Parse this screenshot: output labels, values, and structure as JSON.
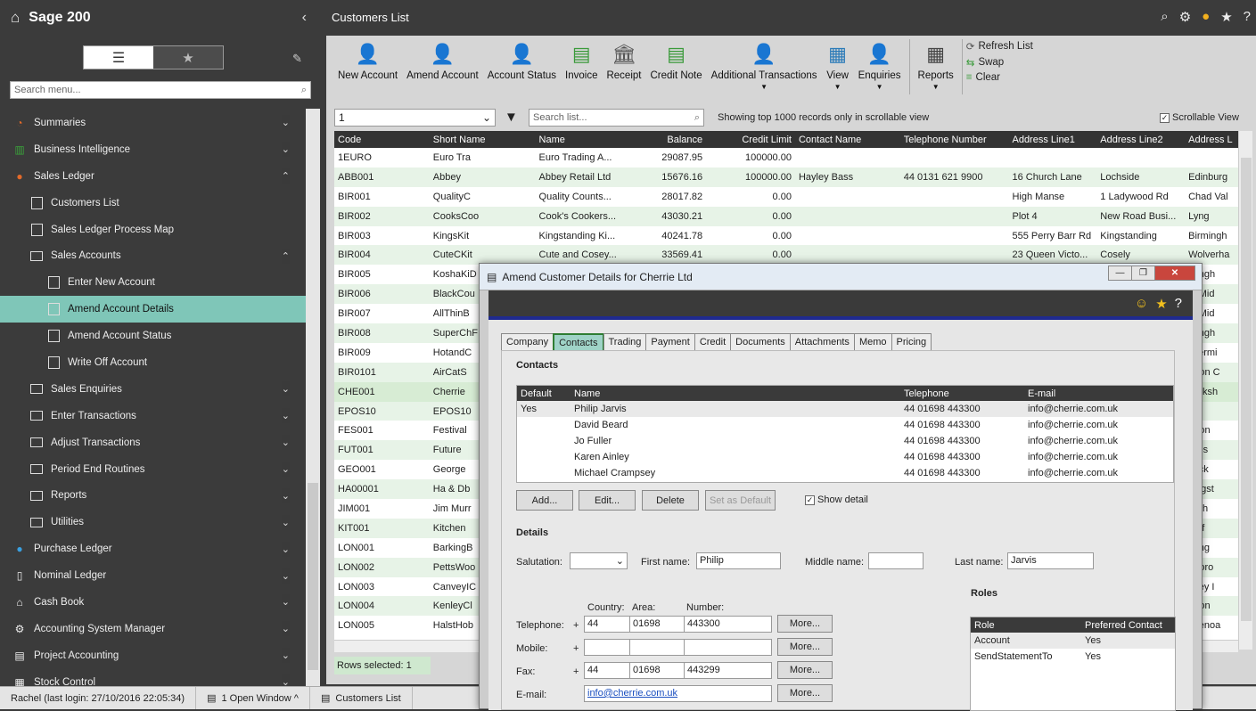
{
  "app": {
    "title": "Sage 200",
    "search_placeholder": "Search menu..."
  },
  "nav": [
    {
      "label": "Summaries",
      "level": 0,
      "icon": "pie-chart-icon",
      "chev": "⌄",
      "sel": false
    },
    {
      "label": "Business Intelligence",
      "level": 0,
      "icon": "bi-icon",
      "chev": "⌄",
      "sel": false
    },
    {
      "label": "Sales Ledger",
      "level": 0,
      "icon": "person-icon",
      "chev": "⌃",
      "sel": false
    },
    {
      "label": "Customers List",
      "level": 1,
      "icon": "list-icon",
      "chev": "",
      "sel": false
    },
    {
      "label": "Sales Ledger Process Map",
      "level": 1,
      "icon": "process-map-icon",
      "chev": "",
      "sel": false
    },
    {
      "label": "Sales Accounts",
      "level": 1,
      "icon": "folder-icon",
      "chev": "⌃",
      "sel": false
    },
    {
      "label": "Enter New Account",
      "level": 2,
      "icon": "form-icon",
      "chev": "",
      "sel": false
    },
    {
      "label": "Amend Account Details",
      "level": 2,
      "icon": "form-icon",
      "chev": "",
      "sel": true
    },
    {
      "label": "Amend Account Status",
      "level": 2,
      "icon": "form-icon",
      "chev": "",
      "sel": false
    },
    {
      "label": "Write Off Account",
      "level": 2,
      "icon": "form-icon",
      "chev": "",
      "sel": false
    },
    {
      "label": "Sales Enquiries",
      "level": 1,
      "icon": "folder-icon",
      "chev": "⌄",
      "sel": false
    },
    {
      "label": "Enter Transactions",
      "level": 1,
      "icon": "folder-icon",
      "chev": "⌄",
      "sel": false
    },
    {
      "label": "Adjust Transactions",
      "level": 1,
      "icon": "folder-icon",
      "chev": "⌄",
      "sel": false
    },
    {
      "label": "Period End Routines",
      "level": 1,
      "icon": "folder-icon",
      "chev": "⌄",
      "sel": false
    },
    {
      "label": "Reports",
      "level": 1,
      "icon": "folder-icon",
      "chev": "⌄",
      "sel": false
    },
    {
      "label": "Utilities",
      "level": 1,
      "icon": "folder-icon",
      "chev": "⌄",
      "sel": false
    },
    {
      "label": "Purchase Ledger",
      "level": 0,
      "icon": "people-icon",
      "chev": "⌄",
      "sel": false
    },
    {
      "label": "Nominal Ledger",
      "level": 0,
      "icon": "book-icon",
      "chev": "⌄",
      "sel": false
    },
    {
      "label": "Cash Book",
      "level": 0,
      "icon": "bank-icon",
      "chev": "⌄",
      "sel": false
    },
    {
      "label": "Accounting System Manager",
      "level": 0,
      "icon": "settings-icon",
      "chev": "⌄",
      "sel": false
    },
    {
      "label": "Project Accounting",
      "level": 0,
      "icon": "clipboard-icon",
      "chev": "⌄",
      "sel": false
    },
    {
      "label": "Stock Control",
      "level": 0,
      "icon": "stock-icon",
      "chev": "⌄",
      "sel": false
    }
  ],
  "page": {
    "title": "Customers List"
  },
  "ribbon": [
    {
      "label": "New Account",
      "icon": "new-account-icon",
      "glyph": "👤",
      "color": "#e36a2a",
      "dd": false
    },
    {
      "label": "Amend Account",
      "icon": "amend-account-icon",
      "glyph": "👤",
      "color": "#e36a2a",
      "dd": false
    },
    {
      "label": "Account Status",
      "icon": "account-status-icon",
      "glyph": "👤",
      "color": "#e36a2a",
      "dd": false
    },
    {
      "label": "Invoice",
      "icon": "invoice-icon",
      "glyph": "▤",
      "color": "#3a9a3a",
      "dd": false
    },
    {
      "label": "Receipt",
      "icon": "receipt-icon",
      "glyph": "🏛",
      "color": "#555555",
      "dd": false
    },
    {
      "label": "Credit Note",
      "icon": "credit-note-icon",
      "glyph": "▤",
      "color": "#3a9a3a",
      "dd": false
    },
    {
      "label": "Additional Transactions",
      "icon": "additional-transactions-icon",
      "glyph": "👤",
      "color": "#e36a2a",
      "dd": true
    },
    {
      "label": "View",
      "icon": "view-icon",
      "glyph": "▦",
      "color": "#2a7ab8",
      "dd": true
    },
    {
      "label": "Enquiries",
      "icon": "enquiries-icon",
      "glyph": "👤",
      "color": "#e36a2a",
      "dd": true
    },
    {
      "label": "Reports",
      "icon": "reports-icon",
      "glyph": "▦",
      "color": "#444444",
      "dd": true
    }
  ],
  "ribbon_small": [
    "Refresh List",
    "Swap",
    "Clear"
  ],
  "filter": {
    "value": "1",
    "search_placeholder": "Search list...",
    "info": "Showing top 1000 records only in scrollable view",
    "scrollable_view": "Scrollable View"
  },
  "columns": [
    "Code",
    "Short Name",
    "Name",
    "Balance",
    "Credit Limit",
    "Contact Name",
    "Telephone Number",
    "Address Line1",
    "Address Line2",
    "Address L"
  ],
  "rows": [
    [
      "1EURO",
      "Euro Tra",
      "Euro Trading A...",
      "29087.95",
      "100000.00",
      "",
      "",
      "",
      "",
      ""
    ],
    [
      "ABB001",
      "Abbey",
      "Abbey Retail Ltd",
      "15676.16",
      "100000.00",
      "Hayley Bass",
      "44 0131 621 9900",
      "16 Church Lane",
      "Lochside",
      "Edinburg"
    ],
    [
      "BIR001",
      "QualityC",
      "Quality Counts...",
      "28017.82",
      "0.00",
      "",
      "",
      "High Manse",
      "1 Ladywood Rd",
      "Chad Val"
    ],
    [
      "BIR002",
      "CooksCoo",
      "Cook's Cookers...",
      "43030.21",
      "0.00",
      "",
      "",
      "Plot 4",
      "New Road Busi...",
      "Lyng"
    ],
    [
      "BIR003",
      "KingsKit",
      "Kingstanding Ki...",
      "40241.78",
      "0.00",
      "",
      "",
      "555 Perry Barr Rd",
      "Kingstanding",
      "Birmingh"
    ],
    [
      "BIR004",
      "CuteCKit",
      "Cute and Cosey...",
      "33569.41",
      "0.00",
      "",
      "",
      "23 Queen Victo...",
      "Cosely",
      "Wolverha"
    ],
    [
      "BIR005",
      "KoshaKiD",
      "",
      "",
      "",
      "",
      "",
      "",
      "",
      "mingh"
    ],
    [
      "BIR006",
      "BlackCou",
      "",
      "",
      "",
      "",
      "",
      "",
      "",
      "st Mid"
    ],
    [
      "BIR007",
      "AllThinB",
      "",
      "",
      "",
      "",
      "",
      "",
      "",
      "st Mid"
    ],
    [
      "BIR008",
      "SuperChF",
      "",
      "",
      "",
      "",
      "",
      "",
      "",
      "mingh"
    ],
    [
      "BIR009",
      "HotandC",
      "",
      "",
      "",
      "",
      "",
      "",
      "",
      "lldermi"
    ],
    [
      "BIR0101",
      "AirCatS",
      "",
      "",
      "",
      "",
      "",
      "",
      "",
      "rston C"
    ],
    [
      "CHE001",
      "Cherrie",
      "",
      "",
      "",
      "",
      "",
      "",
      "",
      "harksh"
    ],
    [
      "EPOS10",
      "EPOS10",
      "",
      "",
      "",
      "",
      "",
      "",
      "",
      ""
    ],
    [
      "FES001",
      "Festival",
      "",
      "",
      "",
      "",
      "",
      "",
      "",
      "ndon"
    ],
    [
      "FUT001",
      "Future",
      "",
      "",
      "",
      "",
      "",
      "",
      "",
      "icles"
    ],
    [
      "GEO001",
      "George",
      "",
      "",
      "",
      "",
      "",
      "",
      "",
      "tlock"
    ],
    [
      "HA00001",
      "Ha & Db",
      "",
      "",
      "",
      "",
      "",
      "",
      "",
      "singst"
    ],
    [
      "JIM001",
      "Jim Murr",
      "",
      "",
      "",
      "",
      "",
      "",
      "",
      "wich"
    ],
    [
      "KIT001",
      "Kitchen",
      "",
      "",
      "",
      "",
      "",
      "",
      "",
      "rdiff"
    ],
    [
      "LON001",
      "BarkingB",
      "",
      "",
      "",
      "",
      "",
      "",
      "",
      "rking"
    ],
    [
      "LON002",
      "PettsWoo",
      "",
      "",
      "",
      "",
      "",
      "",
      "",
      "nboro"
    ],
    [
      "LON003",
      "CanveyIC",
      "",
      "",
      "",
      "",
      "",
      "",
      "",
      "nvey I"
    ],
    [
      "LON004",
      "KenleyCl",
      "",
      "",
      "",
      "",
      "",
      "",
      "",
      "ndon"
    ],
    [
      "LON005",
      "HalstHob",
      "",
      "",
      "",
      "",
      "",
      "",
      "",
      "evenoa"
    ]
  ],
  "rows_selected": "Rows selected: 1",
  "status": {
    "user": "Rachel (last login: 27/10/2016 22:05:34)",
    "windows": "1 Open Window ^",
    "current": "Customers List"
  },
  "dialog": {
    "title": "Amend Customer Details for Cherrie Ltd",
    "tabs": [
      "Company",
      "Contacts",
      "Trading",
      "Payment",
      "Credit",
      "Documents",
      "Attachments",
      "Memo",
      "Pricing"
    ],
    "contacts_heading": "Contacts",
    "contact_cols": [
      "Default",
      "Name",
      "Telephone",
      "E-mail"
    ],
    "contacts": [
      [
        "Yes",
        "Philip Jarvis",
        "44 01698 443300",
        "info@cherrie.com.uk"
      ],
      [
        "",
        "David Beard",
        "44 01698 443300",
        "info@cherrie.com.uk"
      ],
      [
        "",
        "Jo Fuller",
        "44 01698 443300",
        "info@cherrie.com.uk"
      ],
      [
        "",
        "Karen Ainley",
        "44 01698 443300",
        "info@cherrie.com.uk"
      ],
      [
        "",
        "Michael Crampsey",
        "44 01698 443300",
        "info@cherrie.com.uk"
      ]
    ],
    "btn_add": "Add...",
    "btn_edit": "Edit...",
    "btn_delete": "Delete",
    "btn_default": "Set as Default",
    "show_detail": "Show detail",
    "details_heading": "Details",
    "salutation_label": "Salutation:",
    "first_label": "First name:",
    "first_value": "Philip",
    "middle_label": "Middle name:",
    "last_label": "Last name:",
    "last_value": "Jarvis",
    "country_label": "Country:",
    "area_label": "Area:",
    "number_label": "Number:",
    "tel_label": "Telephone:",
    "tel": [
      "44",
      "01698",
      "443300"
    ],
    "mob_label": "Mobile:",
    "fax_label": "Fax:",
    "fax": [
      "44",
      "01698",
      "443299"
    ],
    "email_label": "E-mail:",
    "email": "info@cherrie.com.uk",
    "more": "More...",
    "plus": "+",
    "roles_heading": "Roles",
    "role_cols": [
      "Role",
      "Preferred Contact"
    ],
    "roles": [
      [
        "Account",
        "Yes"
      ],
      [
        "SendStatementTo",
        "Yes"
      ]
    ]
  }
}
